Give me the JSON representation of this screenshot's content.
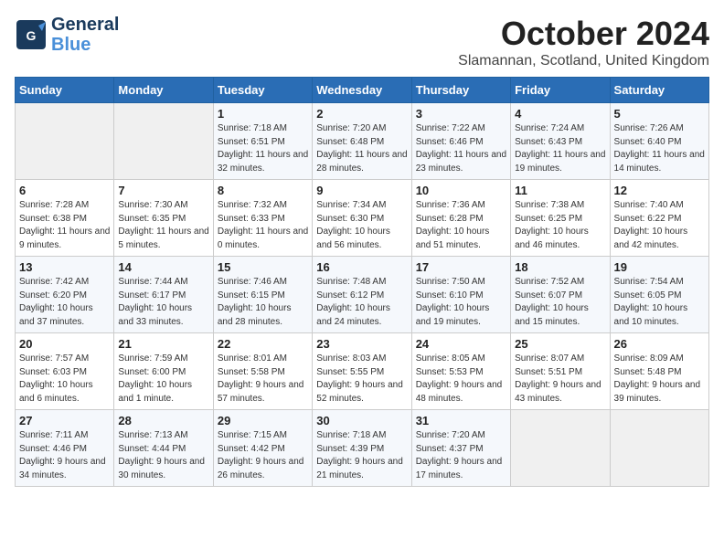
{
  "logo": {
    "line1": "General",
    "line2": "Blue"
  },
  "title": "October 2024",
  "location": "Slamannan, Scotland, United Kingdom",
  "days_header": [
    "Sunday",
    "Monday",
    "Tuesday",
    "Wednesday",
    "Thursday",
    "Friday",
    "Saturday"
  ],
  "weeks": [
    [
      {
        "day": "",
        "sunrise": "",
        "sunset": "",
        "daylight": ""
      },
      {
        "day": "",
        "sunrise": "",
        "sunset": "",
        "daylight": ""
      },
      {
        "day": "1",
        "sunrise": "Sunrise: 7:18 AM",
        "sunset": "Sunset: 6:51 PM",
        "daylight": "Daylight: 11 hours and 32 minutes."
      },
      {
        "day": "2",
        "sunrise": "Sunrise: 7:20 AM",
        "sunset": "Sunset: 6:48 PM",
        "daylight": "Daylight: 11 hours and 28 minutes."
      },
      {
        "day": "3",
        "sunrise": "Sunrise: 7:22 AM",
        "sunset": "Sunset: 6:46 PM",
        "daylight": "Daylight: 11 hours and 23 minutes."
      },
      {
        "day": "4",
        "sunrise": "Sunrise: 7:24 AM",
        "sunset": "Sunset: 6:43 PM",
        "daylight": "Daylight: 11 hours and 19 minutes."
      },
      {
        "day": "5",
        "sunrise": "Sunrise: 7:26 AM",
        "sunset": "Sunset: 6:40 PM",
        "daylight": "Daylight: 11 hours and 14 minutes."
      }
    ],
    [
      {
        "day": "6",
        "sunrise": "Sunrise: 7:28 AM",
        "sunset": "Sunset: 6:38 PM",
        "daylight": "Daylight: 11 hours and 9 minutes."
      },
      {
        "day": "7",
        "sunrise": "Sunrise: 7:30 AM",
        "sunset": "Sunset: 6:35 PM",
        "daylight": "Daylight: 11 hours and 5 minutes."
      },
      {
        "day": "8",
        "sunrise": "Sunrise: 7:32 AM",
        "sunset": "Sunset: 6:33 PM",
        "daylight": "Daylight: 11 hours and 0 minutes."
      },
      {
        "day": "9",
        "sunrise": "Sunrise: 7:34 AM",
        "sunset": "Sunset: 6:30 PM",
        "daylight": "Daylight: 10 hours and 56 minutes."
      },
      {
        "day": "10",
        "sunrise": "Sunrise: 7:36 AM",
        "sunset": "Sunset: 6:28 PM",
        "daylight": "Daylight: 10 hours and 51 minutes."
      },
      {
        "day": "11",
        "sunrise": "Sunrise: 7:38 AM",
        "sunset": "Sunset: 6:25 PM",
        "daylight": "Daylight: 10 hours and 46 minutes."
      },
      {
        "day": "12",
        "sunrise": "Sunrise: 7:40 AM",
        "sunset": "Sunset: 6:22 PM",
        "daylight": "Daylight: 10 hours and 42 minutes."
      }
    ],
    [
      {
        "day": "13",
        "sunrise": "Sunrise: 7:42 AM",
        "sunset": "Sunset: 6:20 PM",
        "daylight": "Daylight: 10 hours and 37 minutes."
      },
      {
        "day": "14",
        "sunrise": "Sunrise: 7:44 AM",
        "sunset": "Sunset: 6:17 PM",
        "daylight": "Daylight: 10 hours and 33 minutes."
      },
      {
        "day": "15",
        "sunrise": "Sunrise: 7:46 AM",
        "sunset": "Sunset: 6:15 PM",
        "daylight": "Daylight: 10 hours and 28 minutes."
      },
      {
        "day": "16",
        "sunrise": "Sunrise: 7:48 AM",
        "sunset": "Sunset: 6:12 PM",
        "daylight": "Daylight: 10 hours and 24 minutes."
      },
      {
        "day": "17",
        "sunrise": "Sunrise: 7:50 AM",
        "sunset": "Sunset: 6:10 PM",
        "daylight": "Daylight: 10 hours and 19 minutes."
      },
      {
        "day": "18",
        "sunrise": "Sunrise: 7:52 AM",
        "sunset": "Sunset: 6:07 PM",
        "daylight": "Daylight: 10 hours and 15 minutes."
      },
      {
        "day": "19",
        "sunrise": "Sunrise: 7:54 AM",
        "sunset": "Sunset: 6:05 PM",
        "daylight": "Daylight: 10 hours and 10 minutes."
      }
    ],
    [
      {
        "day": "20",
        "sunrise": "Sunrise: 7:57 AM",
        "sunset": "Sunset: 6:03 PM",
        "daylight": "Daylight: 10 hours and 6 minutes."
      },
      {
        "day": "21",
        "sunrise": "Sunrise: 7:59 AM",
        "sunset": "Sunset: 6:00 PM",
        "daylight": "Daylight: 10 hours and 1 minute."
      },
      {
        "day": "22",
        "sunrise": "Sunrise: 8:01 AM",
        "sunset": "Sunset: 5:58 PM",
        "daylight": "Daylight: 9 hours and 57 minutes."
      },
      {
        "day": "23",
        "sunrise": "Sunrise: 8:03 AM",
        "sunset": "Sunset: 5:55 PM",
        "daylight": "Daylight: 9 hours and 52 minutes."
      },
      {
        "day": "24",
        "sunrise": "Sunrise: 8:05 AM",
        "sunset": "Sunset: 5:53 PM",
        "daylight": "Daylight: 9 hours and 48 minutes."
      },
      {
        "day": "25",
        "sunrise": "Sunrise: 8:07 AM",
        "sunset": "Sunset: 5:51 PM",
        "daylight": "Daylight: 9 hours and 43 minutes."
      },
      {
        "day": "26",
        "sunrise": "Sunrise: 8:09 AM",
        "sunset": "Sunset: 5:48 PM",
        "daylight": "Daylight: 9 hours and 39 minutes."
      }
    ],
    [
      {
        "day": "27",
        "sunrise": "Sunrise: 7:11 AM",
        "sunset": "Sunset: 4:46 PM",
        "daylight": "Daylight: 9 hours and 34 minutes."
      },
      {
        "day": "28",
        "sunrise": "Sunrise: 7:13 AM",
        "sunset": "Sunset: 4:44 PM",
        "daylight": "Daylight: 9 hours and 30 minutes."
      },
      {
        "day": "29",
        "sunrise": "Sunrise: 7:15 AM",
        "sunset": "Sunset: 4:42 PM",
        "daylight": "Daylight: 9 hours and 26 minutes."
      },
      {
        "day": "30",
        "sunrise": "Sunrise: 7:18 AM",
        "sunset": "Sunset: 4:39 PM",
        "daylight": "Daylight: 9 hours and 21 minutes."
      },
      {
        "day": "31",
        "sunrise": "Sunrise: 7:20 AM",
        "sunset": "Sunset: 4:37 PM",
        "daylight": "Daylight: 9 hours and 17 minutes."
      },
      {
        "day": "",
        "sunrise": "",
        "sunset": "",
        "daylight": ""
      },
      {
        "day": "",
        "sunrise": "",
        "sunset": "",
        "daylight": ""
      }
    ]
  ]
}
